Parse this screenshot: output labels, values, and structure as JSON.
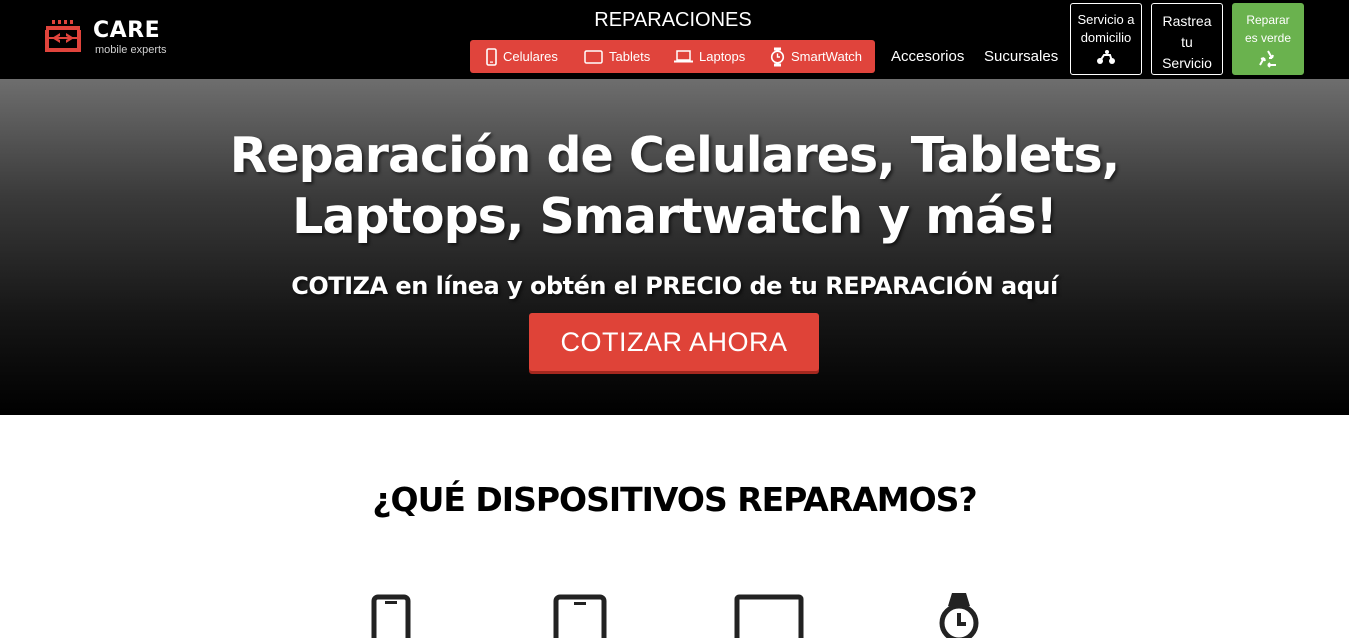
{
  "brand": {
    "name": "CARE",
    "tagline": "mobile experts",
    "accent": "#e0443c"
  },
  "header": {
    "reparaciones_title": "REPARACIONES",
    "repair_menu": [
      {
        "label": "Celulares",
        "icon": "phone-icon"
      },
      {
        "label": "Tablets",
        "icon": "tablet-icon"
      },
      {
        "label": "Laptops",
        "icon": "laptop-icon"
      },
      {
        "label": "SmartWatch",
        "icon": "smartwatch-icon"
      }
    ],
    "nav": [
      {
        "label": "Accesorios"
      },
      {
        "label": "Sucursales"
      }
    ],
    "boxes": {
      "home_service": {
        "line1": "Servicio a",
        "line2": "domicilio",
        "icon": "scooter-icon"
      },
      "track": {
        "line1": "Rastrea",
        "line2": "tu",
        "line3": "Servicio"
      },
      "green": {
        "line1": "Reparar",
        "line2": "es verde",
        "icon": "recycle-icon",
        "color": "#6ab24e"
      }
    }
  },
  "hero": {
    "title_line1": "Reparación de Celulares, Tablets,",
    "title_line2": "Laptops, Smartwatch y más!",
    "subtitle": "COTIZA en línea y obtén el PRECIO de tu REPARACIÓN aquí",
    "cta_label": "COTIZAR AHORA"
  },
  "devices_section": {
    "heading": "¿QUÉ DISPOSITIVOS REPARAMOS?",
    "devices": [
      "phone-icon",
      "tablet-icon",
      "laptop-icon",
      "smartwatch-icon"
    ]
  }
}
